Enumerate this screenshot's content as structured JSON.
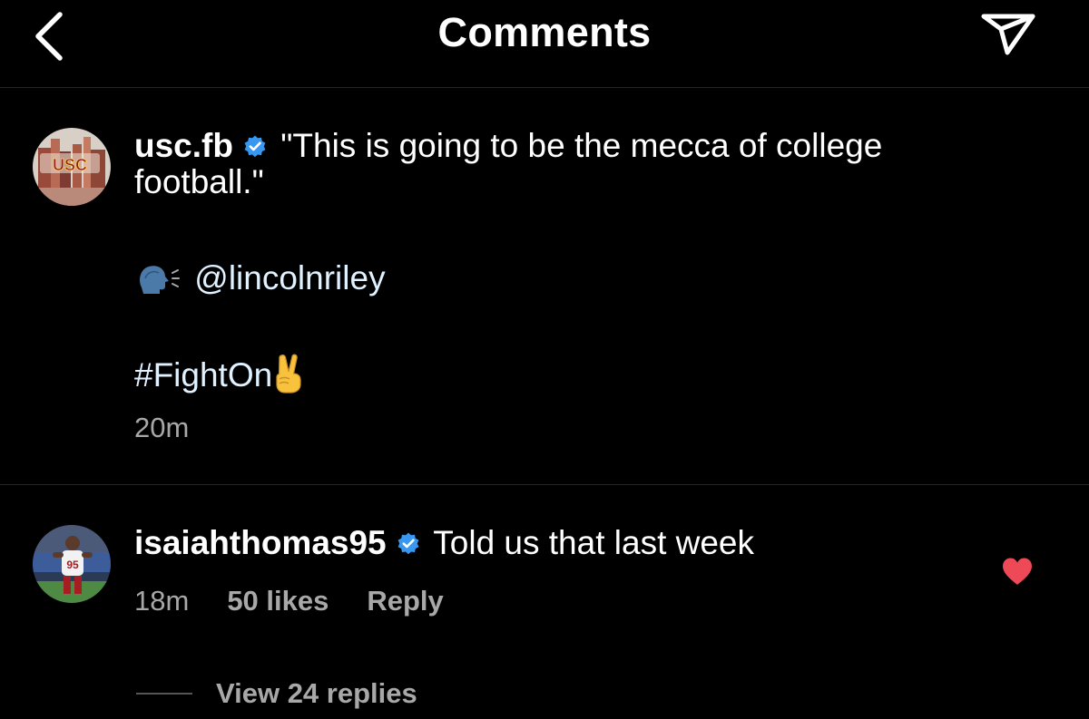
{
  "header": {
    "title": "Comments",
    "back_icon": "chevron-left-icon",
    "send_icon": "paper-plane-icon"
  },
  "post": {
    "username": "usc.fb",
    "verified": true,
    "caption": "\"This is going to be the mecca of college football.\"",
    "speaking_emoji": "speaking-head-emoji",
    "mention": "@lincolnriley",
    "hashtag": "#FightOn",
    "hashtag_emoji": "victory-hand-emoji",
    "time": "20m"
  },
  "comment": {
    "username": "isaiahthomas95",
    "verified": true,
    "text": "Told us that last week",
    "time": "18m",
    "likes": "50 likes",
    "reply_label": "Reply",
    "liked": true,
    "view_replies": "View 24 replies"
  },
  "colors": {
    "background": "#000000",
    "text": "#ffffff",
    "secondary_text": "#a8a8a8",
    "verified_blue": "#3897f0",
    "like_red": "#ed4956",
    "divider": "#262626"
  }
}
